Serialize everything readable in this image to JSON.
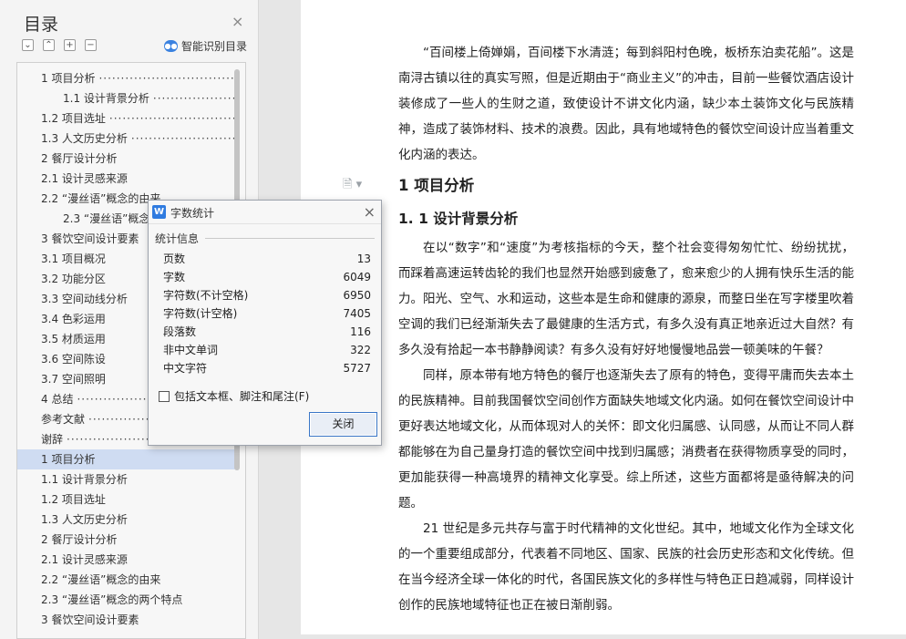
{
  "sidebar": {
    "title": "目录",
    "close": "×",
    "tools": [
      "⌄",
      "⌃",
      "+",
      "−"
    ],
    "smart_toc": "智能识别目录",
    "toc": [
      {
        "label": "1 项目分析",
        "indent": 0,
        "dots": "································"
      },
      {
        "label": "1.1 设计背景分析",
        "indent": 1,
        "dots": "·························"
      },
      {
        "label": "1.2 项目选址",
        "indent": 0,
        "dots": "·······································"
      },
      {
        "label": "1.3 人文历史分析",
        "indent": 0,
        "dots": "·························"
      },
      {
        "label": "2 餐厅设计分析",
        "indent": 0,
        "dots": ""
      },
      {
        "label": "2.1 设计灵感来源",
        "indent": 0,
        "dots": ""
      },
      {
        "label": "2.2 “漫丝语”概念的由来",
        "indent": 0,
        "dots": ""
      },
      {
        "label": "2.3 “漫丝语”概念的两个特点",
        "indent": 1,
        "dots": ""
      },
      {
        "label": "3 餐饮空间设计要素",
        "indent": 0,
        "dots": ""
      },
      {
        "label": "3.1  项目概况",
        "indent": 0,
        "dots": ""
      },
      {
        "label": "3.2  功能分区",
        "indent": 0,
        "dots": ""
      },
      {
        "label": "3.3  空间动线分析",
        "indent": 0,
        "dots": ""
      },
      {
        "label": "3.4  色彩运用",
        "indent": 0,
        "dots": ""
      },
      {
        "label": "3.5  材质运用",
        "indent": 0,
        "dots": ""
      },
      {
        "label": "3.6 空间陈设",
        "indent": 0,
        "dots": ""
      },
      {
        "label": "3.7 空间照明",
        "indent": 0,
        "dots": ""
      },
      {
        "label": "4 总结",
        "indent": 0,
        "dots": "··································································"
      },
      {
        "label": "参考文献",
        "indent": 0,
        "dots": "································"
      },
      {
        "label": "谢辞",
        "indent": 0,
        "dots": "····································"
      },
      {
        "label": "1 项目分析",
        "indent": 0,
        "dots": "",
        "selected": true
      },
      {
        "label": "1.1 设计背景分析",
        "indent": 0,
        "dots": ""
      },
      {
        "label": "1.2 项目选址",
        "indent": 0,
        "dots": ""
      },
      {
        "label": "1.3 人文历史分析",
        "indent": 0,
        "dots": ""
      },
      {
        "label": "2 餐厅设计分析",
        "indent": 0,
        "dots": ""
      },
      {
        "label": "2.1 设计灵感来源",
        "indent": 0,
        "dots": ""
      },
      {
        "label": "2.2 “漫丝语”概念的由来",
        "indent": 0,
        "dots": ""
      },
      {
        "label": "2.3 “漫丝语”概念的两个特点",
        "indent": 0,
        "dots": ""
      },
      {
        "label": "3 餐饮空间设计要素",
        "indent": 0,
        "dots": ""
      }
    ]
  },
  "document": {
    "intro": "“百间楼上倚婵娟，百间楼下水清涟；每到斜阳村色晚，板桥东泊卖花船”。这是南浔古镇以往的真实写照，但是近期由于“商业主义”的冲击，目前一些餐饮酒店设计装修成了一些人的生财之道，致使设计不讲文化内涵，缺少本土装饰文化与民族精神，造成了装饰材料、技术的浪费。因此，具有地域特色的餐饮空间设计应当着重文化内涵的表达。",
    "h1": "1 项目分析",
    "h2": "1. 1 设计背景分析",
    "p1": "在以“数字”和“速度”为考核指标的今天，整个社会变得匆匆忙忙、纷纷扰扰，而踩着高速运转齿轮的我们也显然开始感到疲惫了，愈来愈少的人拥有快乐生活的能力。阳光、空气、水和运动，这些本是生命和健康的源泉，而整日坐在写字楼里吹着空调的我们已经渐渐失去了最健康的生活方式，有多久没有真正地亲近过大自然？有多久没有拾起一本书静静阅读？有多久没有好好地慢慢地品尝一顿美味的午餐？",
    "p2": "同样，原本带有地方特色的餐厅也逐渐失去了原有的特色，变得平庸而失去本土的民族精神。目前我国餐饮空间创作方面缺失地域文化内涵。如何在餐饮空间设计中更好表达地域文化，从而体现对人的关怀：即文化归属感、认同感，从而让不同人群都能够在为自己量身打造的餐饮空间中找到归属感；消费者在获得物质享受的同时，更加能获得一种高境界的精神文化享受。综上所述，这些方面都将是亟待解决的问题。",
    "p3": "21 世纪是多元共存与富于时代精神的文化世纪。其中，地域文化作为全球文化的一个重要组成部分，代表着不同地区、国家、民族的社会历史形态和文化传统。但在当今经济全球一体化的时代，各国民族文化的多样性与特色正日趋减弱，同样设计创作的民族地域特征也正在被日渐削弱。",
    "doc_icon": "🗎 ▾"
  },
  "dialog": {
    "logo": "W",
    "title": "字数统计",
    "close": "×",
    "group_label": "统计信息",
    "stats": [
      {
        "label": "页数",
        "value": "13"
      },
      {
        "label": "字数",
        "value": "6049"
      },
      {
        "label": "字符数(不计空格)",
        "value": "6950"
      },
      {
        "label": "字符数(计空格)",
        "value": "7405"
      },
      {
        "label": "段落数",
        "value": "116"
      },
      {
        "label": "非中文单词",
        "value": "322"
      },
      {
        "label": "中文字符",
        "value": "5727"
      }
    ],
    "checkbox_label": "包括文本框、脚注和尾注(F)",
    "close_button": "关闭"
  }
}
